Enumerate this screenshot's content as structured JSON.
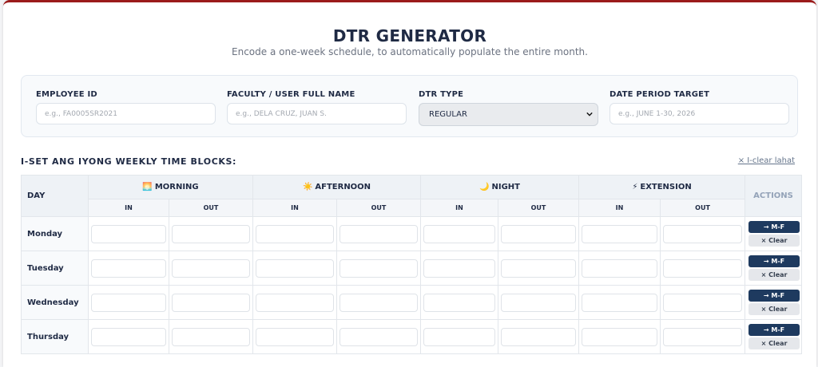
{
  "header": {
    "title": "DTR GENERATOR",
    "subtitle": "Encode a one-week schedule, to automatically populate the entire month."
  },
  "form": {
    "employee_id": {
      "label": "EMPLOYEE ID",
      "placeholder": "e.g., FA0005SR2021",
      "value": ""
    },
    "full_name": {
      "label": "FACULTY / USER FULL NAME",
      "placeholder": "e.g., DELA CRUZ, JUAN S.",
      "value": ""
    },
    "dtr_type": {
      "label": "DTR TYPE",
      "selected": "REGULAR"
    },
    "date_period": {
      "label": "DATE PERIOD TARGET",
      "placeholder": "e.g., JUNE 1-30, 2026",
      "value": ""
    }
  },
  "schedule": {
    "section_label": "I-SET ANG IYONG WEEKLY TIME BLOCKS:",
    "clear_all_label": "× I-clear lahat",
    "columns": {
      "day": "DAY",
      "actions": "ACTIONS",
      "in": "IN",
      "out": "OUT",
      "groups": [
        {
          "icon": "🌅",
          "icon_name": "sunrise-icon",
          "label": "MORNING"
        },
        {
          "icon": "☀️",
          "icon_name": "sun-icon",
          "label": "AFTERNOON"
        },
        {
          "icon": "🌙",
          "icon_name": "moon-icon",
          "label": "NIGHT"
        },
        {
          "icon": "⚡",
          "icon_name": "lightning-icon",
          "label": "EXTENSION"
        }
      ]
    },
    "days": [
      "Monday",
      "Tuesday",
      "Wednesday",
      "Thursday"
    ],
    "actions": {
      "copy_label": "→ M-F",
      "clear_label": "× Clear"
    }
  },
  "colors": {
    "accent_top": "#9b1b1b",
    "primary": "#1e3a5f",
    "text_dark": "#1f2a44",
    "muted": "#6b7280"
  }
}
